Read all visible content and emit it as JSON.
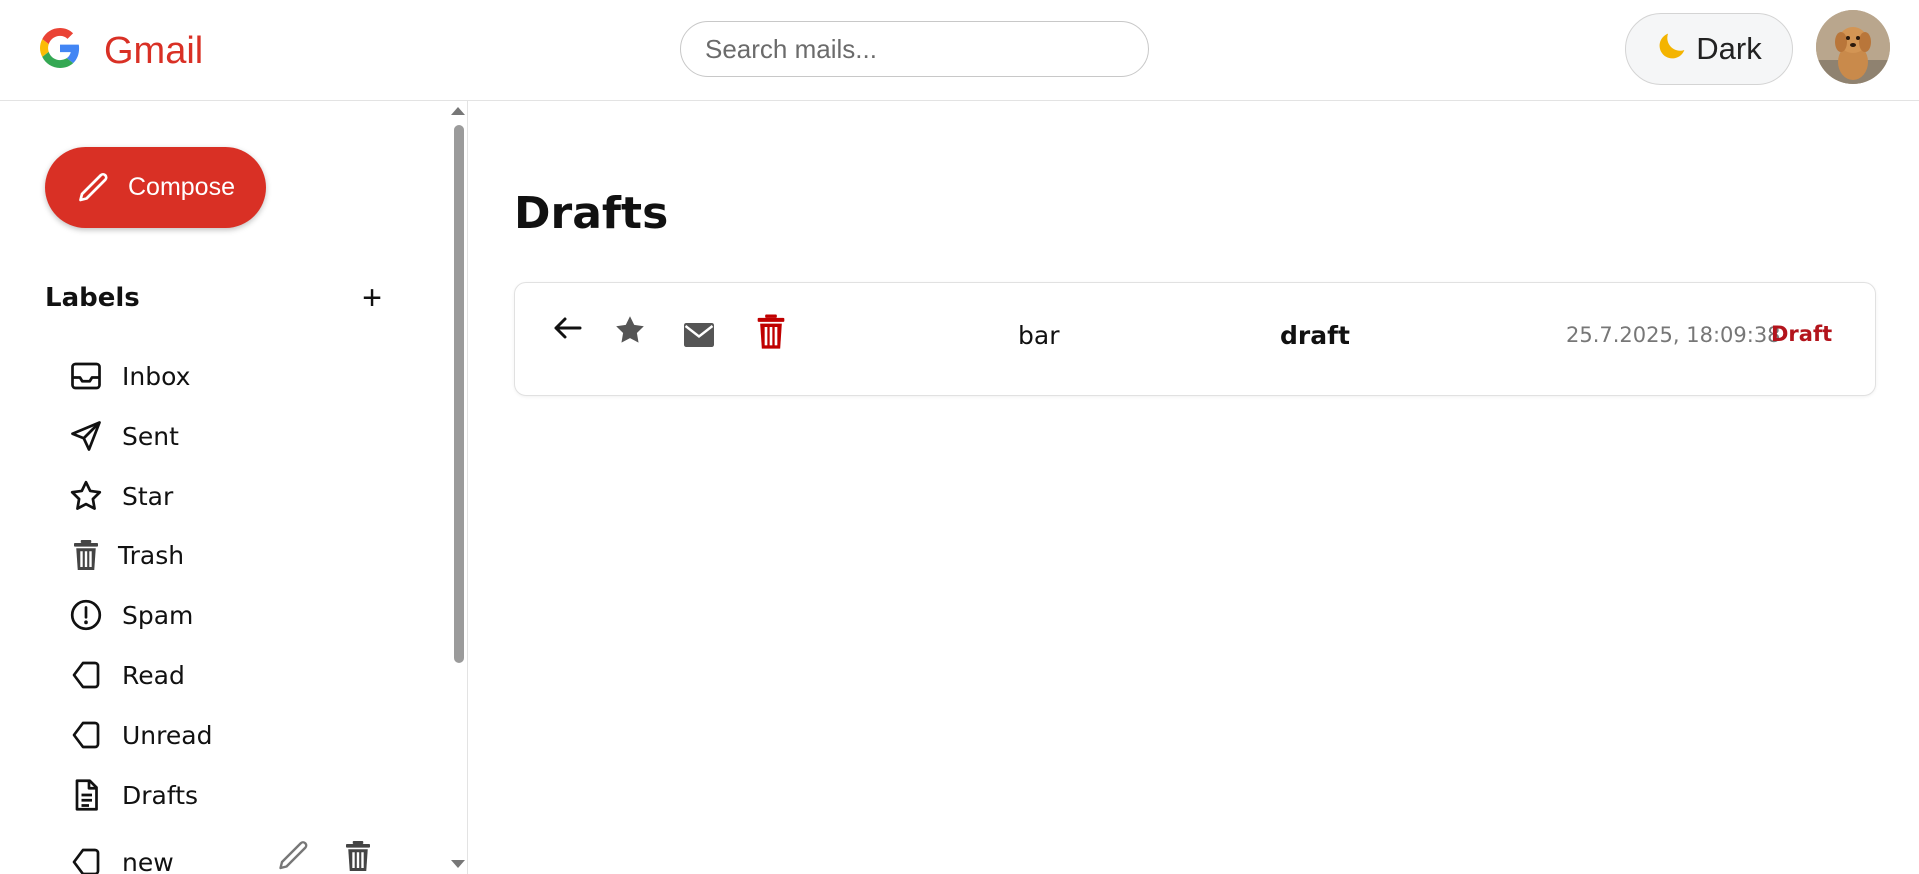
{
  "header": {
    "app_name": "Gmail",
    "search_placeholder": "Search mails...",
    "theme_label": "Dark",
    "theme_icon": "moon-icon"
  },
  "sidebar": {
    "compose_label": "Compose",
    "labels_title": "Labels",
    "add_label_symbol": "+",
    "items": [
      {
        "label": "Inbox",
        "icon": "inbox-icon"
      },
      {
        "label": "Sent",
        "icon": "send-icon"
      },
      {
        "label": "Star",
        "icon": "star-icon"
      },
      {
        "label": "Trash",
        "icon": "trash-icon"
      },
      {
        "label": "Spam",
        "icon": "alert-icon"
      },
      {
        "label": "Read",
        "icon": "tag-icon"
      },
      {
        "label": "Unread",
        "icon": "tag-icon"
      },
      {
        "label": "Drafts",
        "icon": "document-icon"
      },
      {
        "label": "new",
        "icon": "tag-icon"
      }
    ]
  },
  "main": {
    "title": "Drafts",
    "mails": [
      {
        "from": "bar",
        "subject": "draft",
        "date": "25.7.2025, 18:09:38",
        "tag": "Draft"
      }
    ]
  },
  "colors": {
    "brand_red": "#d93025",
    "draft_tag": "#b3141c",
    "trash_red": "#c00000"
  }
}
